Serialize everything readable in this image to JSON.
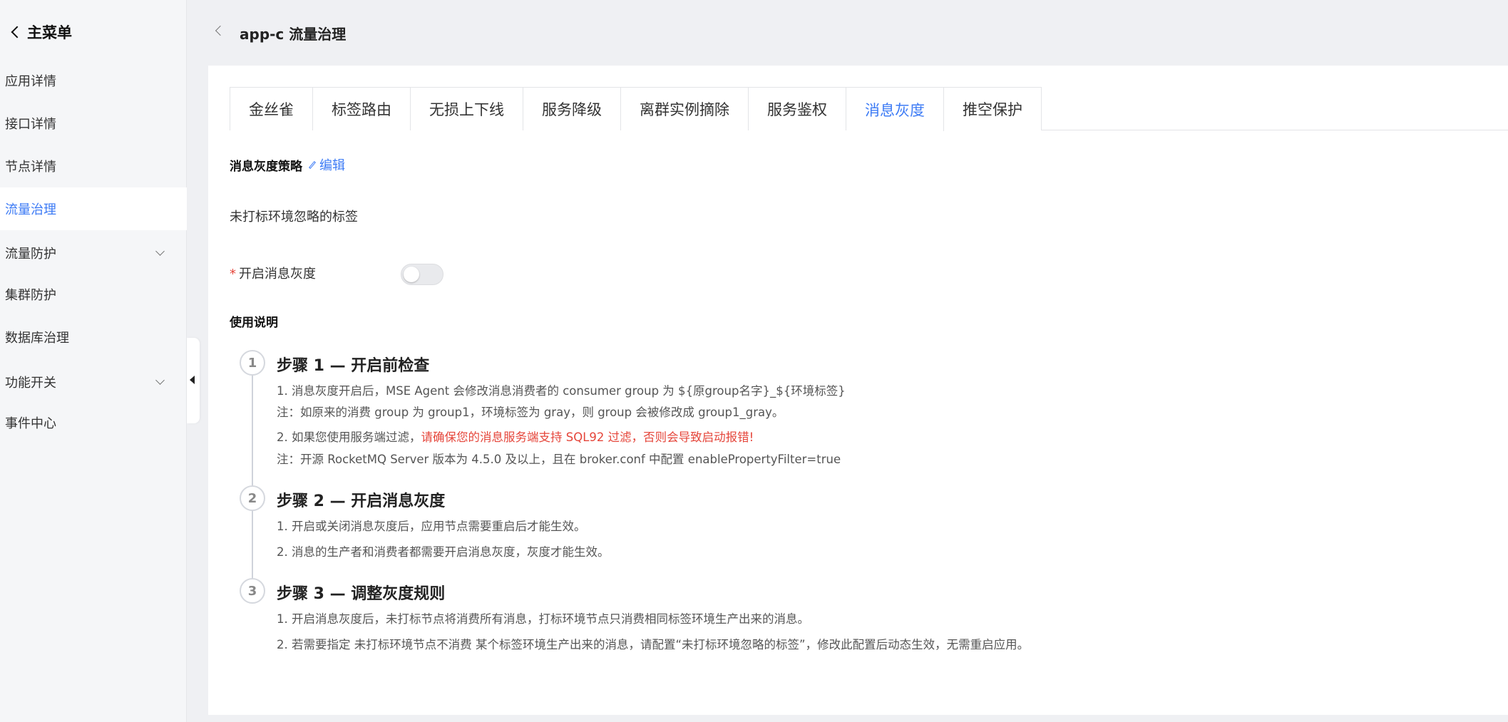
{
  "sidebar": {
    "header": "主菜单",
    "items": [
      {
        "label": "应用详情"
      },
      {
        "label": "接口详情"
      },
      {
        "label": "节点详情"
      },
      {
        "label": "流量治理"
      },
      {
        "label": "流量防护"
      },
      {
        "label": "集群防护"
      },
      {
        "label": "数据库治理"
      },
      {
        "label": "功能开关"
      },
      {
        "label": "事件中心"
      }
    ],
    "active_item": "流量治理"
  },
  "header": {
    "title": "app-c 流量治理"
  },
  "tabs": [
    {
      "label": "金丝雀"
    },
    {
      "label": "标签路由"
    },
    {
      "label": "无损上下线"
    },
    {
      "label": "服务降级"
    },
    {
      "label": "离群实例摘除"
    },
    {
      "label": "服务鉴权"
    },
    {
      "label": "消息灰度"
    },
    {
      "label": "推空保护"
    }
  ],
  "active_tab": "消息灰度",
  "policy": {
    "title": "消息灰度策略",
    "edit_label": "编辑",
    "ignored_tags_label": "未打标环境忽略的标签",
    "switch_required_mark": "*",
    "switch_label": "开启消息灰度",
    "switch_on": false
  },
  "usage": {
    "title": "使用说明",
    "steps": [
      {
        "number": "1",
        "title": "步骤 1 — 开启前检查",
        "lines": [
          "1. 消息灰度开启后，MSE Agent 会修改消息消费者的 consumer group 为 ${原group名字}_${环境标签}",
          "注：如原来的消费 group 为 group1，环境标签为 gray，则 group 会被修改成 group1_gray。",
          "注：开源 RocketMQ Server 版本为 4.5.0 及以上，且在 broker.conf 中配置 enablePropertyFilter=true"
        ],
        "warn_prefix": "2. 如果您使用服务端过滤，",
        "warn_text": "请确保您的消息服务端支持 SQL92 过滤，否则会导致启动报错!"
      },
      {
        "number": "2",
        "title": "步骤 2 — 开启消息灰度",
        "lines": [
          "1. 开启或关闭消息灰度后，应用节点需要重启后才能生效。",
          "2. 消息的生产者和消费者都需要开启消息灰度，灰度才能生效。"
        ]
      },
      {
        "number": "3",
        "title": "步骤 3 — 调整灰度规则",
        "lines": [
          "1. 开启消息灰度后，未打标节点将消费所有消息，打标环境节点只消费相同标签环境生产出来的消息。",
          "2. 若需要指定 未打标环境节点不消费 某个标签环境生产出来的消息，请配置“未打标环境忽略的标签”，修改此配置后动态生效，无需重启应用。"
        ]
      }
    ]
  },
  "colors": {
    "accent": "#3d7bf5",
    "warning": "#e5453a"
  }
}
